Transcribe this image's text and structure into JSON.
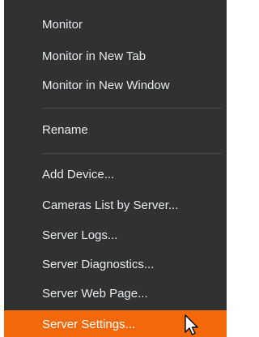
{
  "menu": {
    "items": [
      {
        "label": "Monitor"
      },
      {
        "label": "Monitor in New Tab"
      },
      {
        "label": "Monitor in New Window"
      },
      {
        "label": "Rename"
      },
      {
        "label": "Add Device..."
      },
      {
        "label": "Cameras List by Server..."
      },
      {
        "label": "Server Logs..."
      },
      {
        "label": "Server Diagnostics..."
      },
      {
        "label": "Server Web Page..."
      },
      {
        "label": "Server Settings...",
        "highlighted": true
      }
    ]
  },
  "colors": {
    "menu_background": "#2f3133",
    "menu_text": "#e9ecee",
    "highlight": "#f1690a",
    "separator": "#464a4d"
  },
  "icons": {
    "cursor": "mouse-pointer-icon"
  }
}
